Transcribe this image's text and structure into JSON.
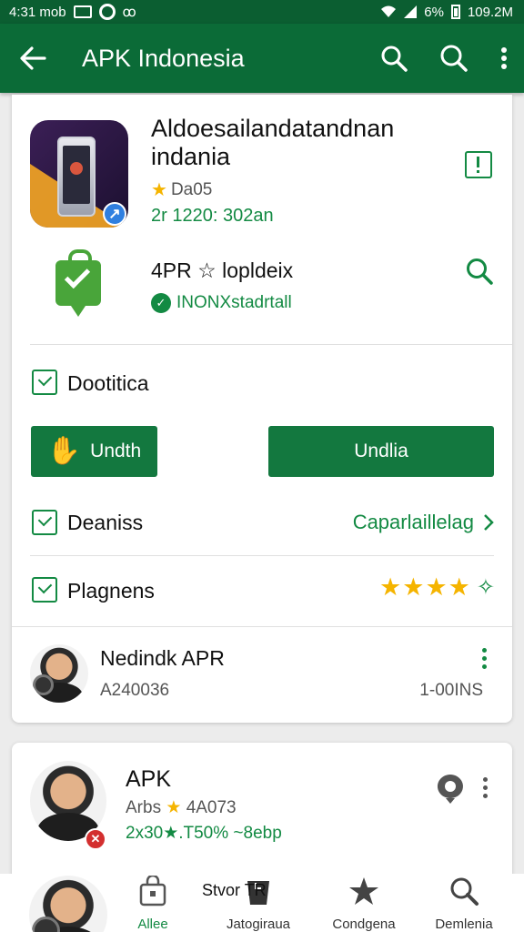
{
  "status_bar": {
    "time": "4:31 mob",
    "battery": "6%",
    "data": "109.2M"
  },
  "appbar": {
    "title": "APK Indonesia"
  },
  "colors": {
    "primary": "#0b6b37",
    "accent": "#138a43",
    "star": "#f5b400"
  },
  "top_app": {
    "name": "Aldoesailandatandnan indania",
    "rating": "Da05",
    "meta": "2r 1220: 302an"
  },
  "second_app": {
    "name": "4PR ☆ lopldeix",
    "sub": "INONXstadrtall"
  },
  "sections": {
    "checkbox_1": "Dootitica",
    "button_left": "Undth",
    "button_right": "Undlia",
    "checkbox_2": "Deaniss",
    "checkbox_2_right": "Caparlaillelag",
    "checkbox_3": "Plagnens",
    "rating_stars": 4
  },
  "review": {
    "name": "Nedindk APR",
    "sub": "A240036",
    "right": "1-00INS"
  },
  "card2": {
    "name": "APK",
    "sub_prefix": "Arbs",
    "sub_suffix": "4A073",
    "meta": "2x30★.T50% ~8ebp"
  },
  "bottom_nav": {
    "overlay_text": "Stvor TR",
    "items": [
      {
        "label": "Allee",
        "icon": "bag-icon"
      },
      {
        "label": "Jatogiraua",
        "icon": "shopping-icon"
      },
      {
        "label": "Condgena",
        "icon": "star-icon"
      },
      {
        "label": "Demlenia",
        "icon": "search-icon"
      }
    ]
  }
}
